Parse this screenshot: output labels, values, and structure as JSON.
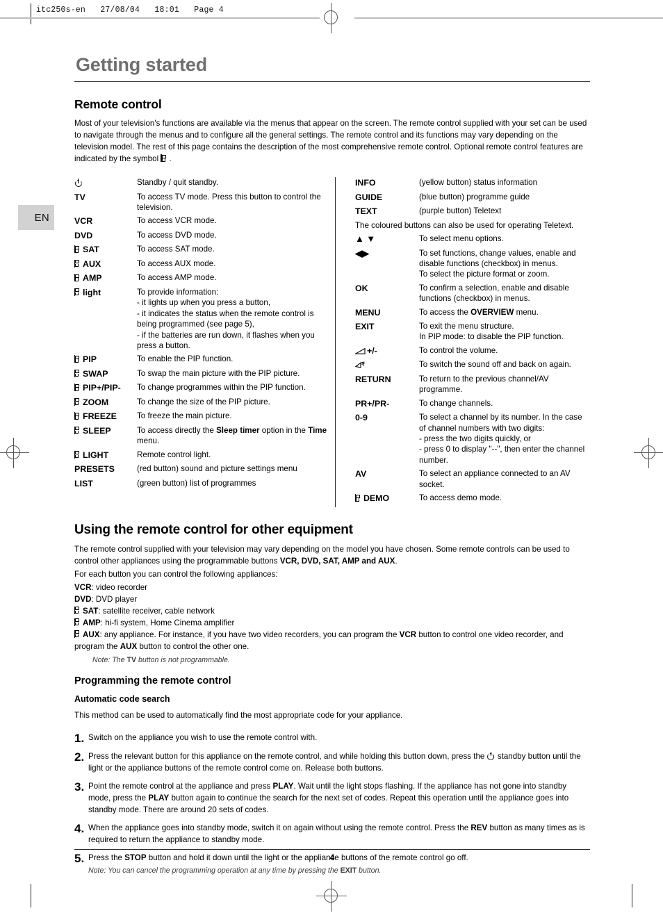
{
  "print_header": "itc250s-en   27/08/04   18:01   Page 4",
  "language_tab": "EN",
  "chapter_title": "Getting started",
  "remote_control": {
    "heading": "Remote control",
    "intro_1": "Most of your television's functions are available via the menus that appear on the screen. The remote control supplied with your set can be used to navigate through the menus and to configure all the general settings. The remote control and its functions may vary depending on the television model. The rest of this page contains the description of the most comprehensive remote control. Optional remote control features are indicated by the symbol",
    "intro_1_end": ".",
    "left_column": [
      {
        "key": "",
        "key_icon": "power-icon",
        "optional": false,
        "desc": "Standby / quit standby."
      },
      {
        "key": "TV",
        "optional": false,
        "desc": "To access TV mode. Press this button to control the television."
      },
      {
        "key": "VCR",
        "optional": false,
        "desc": "To access VCR mode."
      },
      {
        "key": "DVD",
        "optional": false,
        "desc": "To access DVD mode."
      },
      {
        "key": "SAT",
        "optional": true,
        "desc": "To access SAT mode."
      },
      {
        "key": "AUX",
        "optional": true,
        "desc": "To access AUX mode."
      },
      {
        "key": "AMP",
        "optional": true,
        "desc": "To access AMP mode."
      },
      {
        "key": "light",
        "optional": true,
        "desc": "To provide information:",
        "sublines": [
          "- it lights up when you press a button,",
          "- it indicates the status when the remote control is being programmed (see page 5),",
          "- if the batteries are run down, it flashes when you press a button."
        ]
      },
      {
        "key": "PIP",
        "optional": true,
        "desc": "To enable the PIP function."
      },
      {
        "key": "SWAP",
        "optional": true,
        "desc": "To swap the main picture with the PIP picture."
      },
      {
        "key": "PIP+/PIP-",
        "optional": true,
        "desc": "To change programmes within the PIP function."
      },
      {
        "key": "ZOOM",
        "optional": true,
        "desc": "To change the size of the PIP picture."
      },
      {
        "key": "FREEZE",
        "optional": true,
        "desc": "To freeze the main picture."
      },
      {
        "key": "SLEEP",
        "optional": true,
        "desc_html": "To access directly the <b>Sleep timer</b> option in the <b>Time</b> menu."
      },
      {
        "key": "LIGHT",
        "optional": true,
        "desc": "Remote control light."
      },
      {
        "key": "PRESETS",
        "optional": false,
        "desc": "(red button) sound and picture settings menu"
      },
      {
        "key": "LIST",
        "optional": false,
        "desc": "(green button)  list of programmes"
      }
    ],
    "right_column": [
      {
        "key": "INFO",
        "optional": false,
        "desc": "(yellow button) status information"
      },
      {
        "key": "GUIDE",
        "optional": false,
        "desc": "(blue button) programme guide"
      },
      {
        "key": "TEXT",
        "optional": false,
        "desc": "(purple button) Teletext"
      },
      {
        "fullwidth": "The coloured buttons can also be used for operating Teletext."
      },
      {
        "key": "",
        "key_icon": "up-down-arrows-icon",
        "optional": false,
        "desc": "To select menu options."
      },
      {
        "key": "",
        "key_icon": "left-right-arrows-icon",
        "optional": false,
        "desc": "To set functions, change values, enable and disable functions (checkbox) in menus.",
        "sublines": [
          "To select the picture format or zoom."
        ]
      },
      {
        "key": "OK",
        "optional": false,
        "desc": "To confirm a selection, enable and disable functions (checkbox) in menus."
      },
      {
        "key": "MENU",
        "optional": false,
        "desc_html": "To access the <b>OVERVIEW</b> menu."
      },
      {
        "key": "EXIT",
        "optional": false,
        "desc": "To exit the menu structure.",
        "sublines": [
          "In PIP mode: to disable the PIP function."
        ]
      },
      {
        "key": "+/-",
        "key_icon": "volume-icon",
        "optional": false,
        "desc": "To control the volume."
      },
      {
        "key": "",
        "key_icon": "mute-icon",
        "optional": false,
        "desc": "To switch the sound off and back on again."
      },
      {
        "key": "RETURN",
        "optional": false,
        "desc": "To return to the previous channel/AV programme."
      },
      {
        "key": "PR+/PR-",
        "optional": false,
        "desc": "To change channels."
      },
      {
        "key": "0-9",
        "optional": false,
        "desc": "To select a channel by its number. In the case of channel numbers with two digits:",
        "sublines": [
          "- press the two digits quickly, or",
          "- press 0 to display \"--\", then enter the channel number."
        ]
      },
      {
        "key": "AV",
        "optional": false,
        "desc": "To select an appliance connected to an AV socket."
      },
      {
        "key": "DEMO",
        "optional": true,
        "desc": "To access demo mode."
      }
    ]
  },
  "other_equipment": {
    "heading": "Using the remote control for other equipment",
    "para_1_a": "The remote control supplied with your television may vary depending on the model you have chosen. Some remote controls can be used to control other appliances using the programmable buttons ",
    "para_1_keys": "VCR, DVD, SAT, AMP and AUX",
    "para_1_b": ".",
    "para_2": "For each button you can control the following appliances:",
    "appliances": [
      {
        "key": "VCR",
        "optional": false,
        "text": ": video recorder"
      },
      {
        "key": "DVD",
        "optional": false,
        "text": ": DVD player"
      },
      {
        "key": "SAT",
        "optional": true,
        "text": ": satellite receiver, cable network"
      },
      {
        "key": "AMP",
        "optional": true,
        "text": ": hi-fi system, Home Cinema amplifier"
      },
      {
        "key": "AUX",
        "optional": true,
        "text_html": ": any appliance. For instance, if you have two video recorders, you can program the <b>VCR</b> button to control one video recorder, and program the <b>AUX</b> button to control the other one."
      }
    ],
    "note_html": "Note: The <b>TV</b> button is not programmable."
  },
  "programming": {
    "heading": "Programming the remote control",
    "subheading": "Automatic code search",
    "intro": "This method can be used to automatically find the most appropriate code for your appliance.",
    "steps": [
      {
        "num": "1.",
        "text_html": "Switch on the appliance you wish to use the remote control with."
      },
      {
        "num": "2.",
        "text_html": "Press the relevant button for this appliance on the remote control, and while holding this button down, press the <span class=\"pwrslot\"></span> standby button until the light or the appliance buttons of the remote control come on. Release both buttons."
      },
      {
        "num": "3.",
        "text_html": "Point the remote control at the appliance and press <b>PLAY</b>. Wait until the light stops flashing. If the appliance has not gone into standby mode, press the <b>PLAY</b> button again to continue the search for the next set of codes. Repeat this operation until the appliance goes into standby mode. There are around 20 sets of codes."
      },
      {
        "num": "4.",
        "text_html": "When the appliance goes into standby mode, switch it on again without using the remote control. Press the <b>REV</b> button as many times as is required to return the appliance to standby mode."
      },
      {
        "num": "5.",
        "text_html": "Press the <b>STOP</b> button and hold it down until the light or the appliance buttons of the remote control go off.",
        "note_html": "Note: You can cancel the programming operation at any time by pressing the <b>EXIT</b> button."
      }
    ]
  },
  "footer_page_number": "4"
}
